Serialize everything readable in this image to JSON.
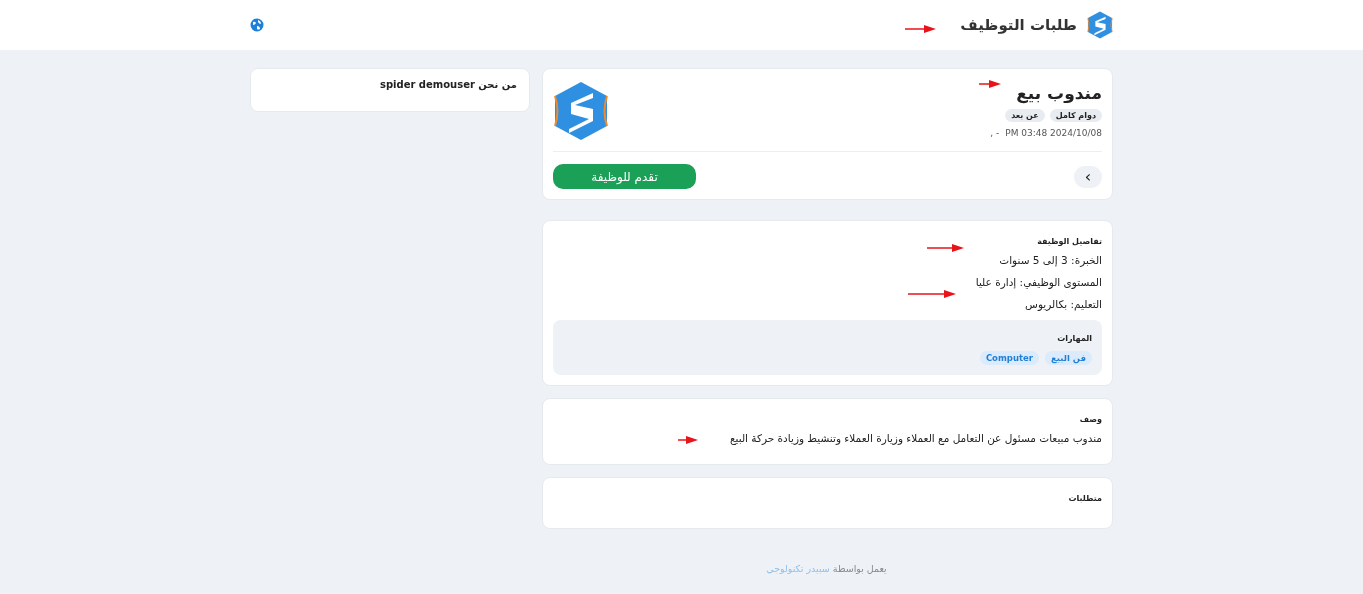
{
  "header": {
    "title": "طلبات التوظيف"
  },
  "job": {
    "title": "مندوب بيع",
    "tags": [
      "دوام كامل",
      "عن بعد"
    ],
    "posted": "PM 03:48 2024/10/08",
    "location": "- ,",
    "nav_button": "›",
    "apply_button": "تقدم للوظيفة"
  },
  "details": {
    "title": "تفاصيل الوظيفة",
    "rows": [
      "الخبرة: 3 إلى 5 سنوات",
      "المستوى الوظيفي: إدارة عليا",
      "التعليم: بكالريوس"
    ],
    "skills": {
      "title": "المهارات",
      "items": [
        "فن البيع",
        "Computer"
      ]
    }
  },
  "description": {
    "title": "وصف",
    "text": "مندوب مبيعات مسئول عن التعامل مع العملاء وزيارة العملاء وتنشيط وزيادة حركة البيع"
  },
  "requirements": {
    "title": "متطلبات"
  },
  "about": {
    "title": "من نحن spider demouser"
  },
  "footer": {
    "text": "يعمل بواسطة",
    "link": "سبيدر تكنولوجي"
  }
}
